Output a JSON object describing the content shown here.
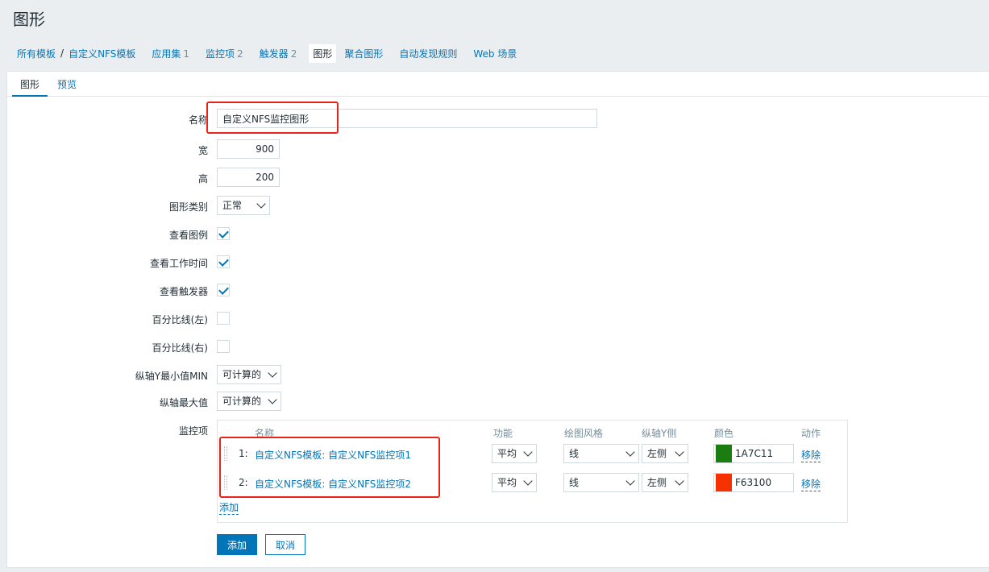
{
  "page": {
    "title": "图形"
  },
  "breadcrumbs": {
    "all_templates": "所有模板",
    "separator": "/",
    "template": "自定义NFS模板",
    "applications": {
      "label": "应用集",
      "count": "1"
    },
    "items": {
      "label": "监控项",
      "count": "2"
    },
    "triggers": {
      "label": "触发器",
      "count": "2"
    },
    "graphs": "图形",
    "screens": "聚合图形",
    "discovery": "自动发现规则",
    "web": "Web 场景"
  },
  "tabs": {
    "graph": "图形",
    "preview": "预览"
  },
  "form": {
    "name": {
      "label": "名称",
      "value": "自定义NFS监控图形"
    },
    "width": {
      "label": "宽",
      "value": "900"
    },
    "height": {
      "label": "高",
      "value": "200"
    },
    "graph_type": {
      "label": "图形类别",
      "value": "正常"
    },
    "show_legend": {
      "label": "查看图例",
      "checked": true
    },
    "show_working_time": {
      "label": "查看工作时间",
      "checked": true
    },
    "show_triggers": {
      "label": "查看触发器",
      "checked": true
    },
    "percentile_left": {
      "label": "百分比线(左)",
      "checked": false
    },
    "percentile_right": {
      "label": "百分比线(右)",
      "checked": false
    },
    "ymin": {
      "label": "纵轴Y最小值MIN",
      "value": "可计算的"
    },
    "ymax": {
      "label": "纵轴最大值",
      "value": "可计算的"
    },
    "items_label": "监控项"
  },
  "items_table": {
    "headers": {
      "name": "名称",
      "function": "功能",
      "draw_style": "绘图风格",
      "y_axis_side": "纵轴Y侧",
      "color": "颜色",
      "action": "动作"
    },
    "rows": [
      {
        "num": "1:",
        "name": "自定义NFS模板: 自定义NFS监控项1",
        "function": "平均",
        "draw_style": "线",
        "y_side": "左侧",
        "color": "1A7C11",
        "color_hex": "#1A7C11",
        "action": "移除"
      },
      {
        "num": "2:",
        "name": "自定义NFS模板: 自定义NFS监控项2",
        "function": "平均",
        "draw_style": "线",
        "y_side": "左侧",
        "color": "F63100",
        "color_hex": "#F63100",
        "action": "移除"
      }
    ],
    "add_link": "添加"
  },
  "buttons": {
    "add": "添加",
    "cancel": "取消"
  },
  "colors": {
    "accent": "#0275b8",
    "highlight": "#e8241a"
  }
}
